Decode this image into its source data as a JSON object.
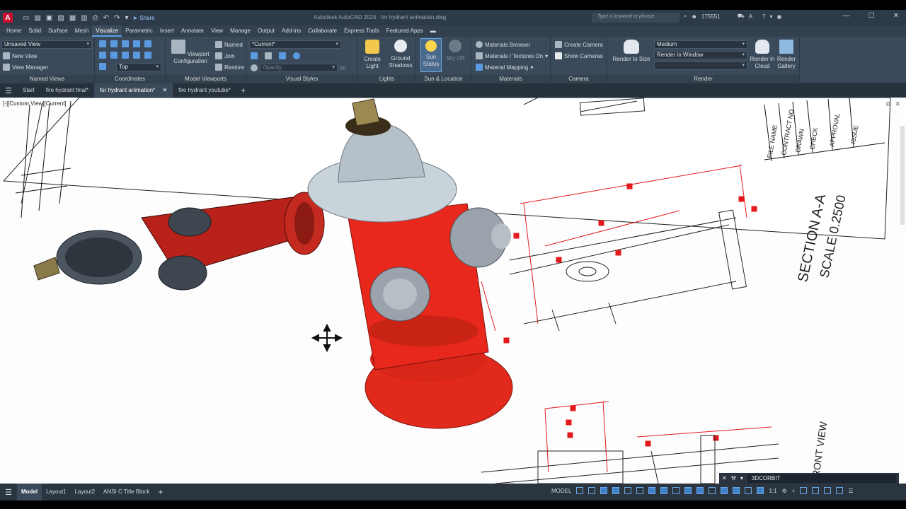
{
  "app": {
    "logo_letter": "A",
    "title": "Autodesk AutoCAD 2024",
    "file": "for hydrant animation.dwg",
    "share": "Share",
    "search_placeholder": "Type a keyword or phrase",
    "user": "175551"
  },
  "ribbon_tabs": [
    "Home",
    "Solid",
    "Surface",
    "Mesh",
    "Visualize",
    "Parametric",
    "Insert",
    "Annotate",
    "View",
    "Manage",
    "Output",
    "Add-ins",
    "Collaborate",
    "Express Tools",
    "Featured Apps"
  ],
  "active_ribbon_tab": "Visualize",
  "panels": {
    "named_views": {
      "title": "Named Views",
      "combo": "Unsaved View",
      "new_view": "New View",
      "view_manager": "View Manager"
    },
    "coordinates": {
      "title": "Coordinates",
      "combo": "Top"
    },
    "viewports": {
      "title": "Model Viewports",
      "viewport_config": "Viewport Configuration",
      "named": "Named",
      "join": "Join",
      "restore": "Restore"
    },
    "visual_styles": {
      "title": "Visual Styles",
      "combo": "*Current*",
      "opacity_label": "Opacity",
      "opacity_value": "60"
    },
    "lights": {
      "title": "Lights",
      "create_light": "Create Light",
      "ground_shadows": "Ground Shadows"
    },
    "sun": {
      "title": "Sun & Location",
      "sun_status": "Sun Status",
      "sky_off": "Sky Off"
    },
    "materials": {
      "title": "Materials",
      "browser": "Materials Browser",
      "textures": "Materials / Textures On",
      "mapping": "Material Mapping"
    },
    "camera": {
      "title": "Camera",
      "create_camera": "Create Camera",
      "show_cameras": "Show Cameras"
    },
    "render": {
      "title": "Render",
      "render_to_size": "Render to Size",
      "quality": "Medium",
      "target": "Render in Window",
      "render_cloud": "Render in Cloud",
      "render_gallery": "Render Gallery"
    }
  },
  "doc_tabs": [
    "Start",
    "fire hydrant final*",
    "for hydrant animation*",
    "fire hydrant youtube*"
  ],
  "active_doc_tab": "for hydrant animation*",
  "viewport": {
    "label": "[-][Custom View][Current]",
    "drawing_text": {
      "section": "SECTION A-A",
      "scale": "SCALE 0.2500",
      "front_view": "FRONT VIEW",
      "title_block": [
        "FILE NAME",
        "CONTRACT NO",
        "DRAWN",
        "CHECK",
        "APPROVAL",
        "ISSUE"
      ]
    },
    "command_line": "3DCORBIT"
  },
  "layout_tabs": [
    "Model",
    "Layout1",
    "Layout2",
    "ANSI C Title Block"
  ],
  "active_layout_tab": "Model",
  "status": {
    "model_label": "MODEL",
    "scale": "1:1"
  },
  "colors": {
    "accent": "#5aa0e6",
    "logo_red": "#c8102e",
    "hydrant_red": "#e8281c",
    "dimension_red": "#e31a1c"
  }
}
